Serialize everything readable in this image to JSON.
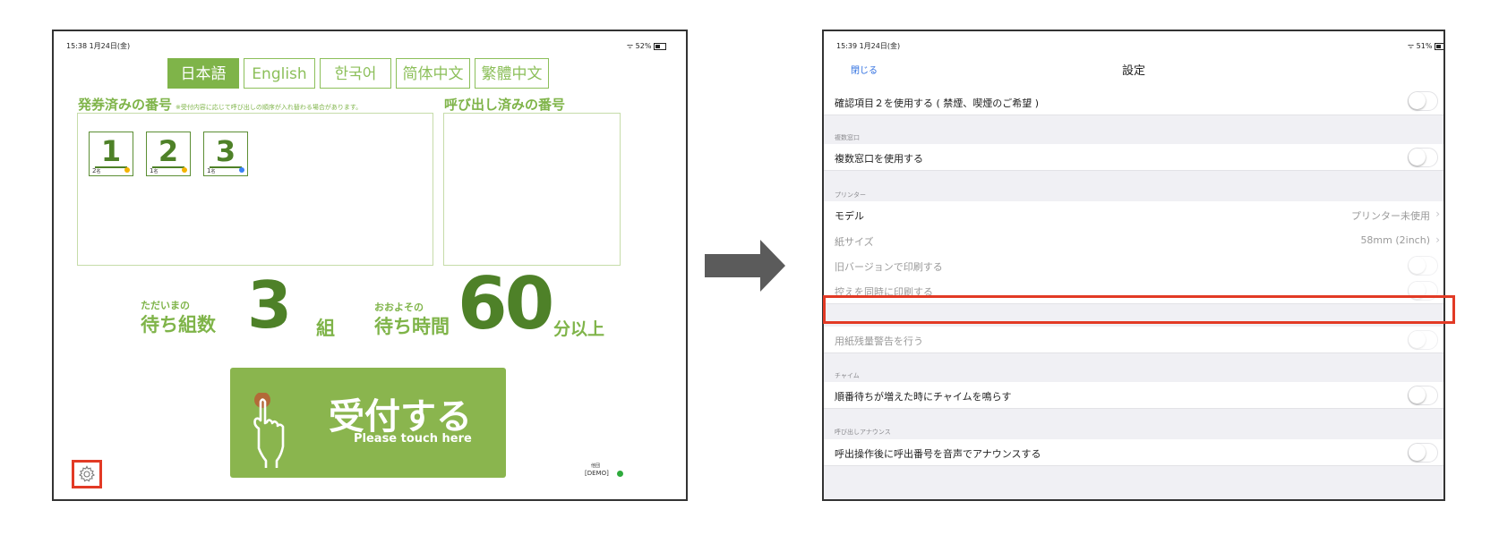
{
  "left": {
    "status_time": "15:38  1月24日(金)",
    "status_battery": "52%",
    "tabs": [
      "日本語",
      "English",
      "한국어",
      "简体中文",
      "繁體中文"
    ],
    "issued": {
      "title": "発券済みの番号",
      "note": "※受付内容に応じて呼び出しの順序が入れ替わる場合があります。",
      "tickets": [
        {
          "number": "1",
          "count": "2",
          "unit": "名",
          "dot_color": "#f4b400"
        },
        {
          "number": "2",
          "count": "1",
          "unit": "名",
          "dot_color": "#f4b400"
        },
        {
          "number": "3",
          "count": "1",
          "unit": "名",
          "dot_color": "#3b82f6"
        }
      ]
    },
    "called": {
      "title": "呼び出し済みの番号"
    },
    "wait_groups": {
      "small": "ただいまの",
      "label": "待ち組数",
      "value": "3",
      "unit": "組"
    },
    "wait_time": {
      "small": "おおよその",
      "label": "待ち時間",
      "value": "60",
      "unit": "分以上"
    },
    "accept_button": {
      "label": "受付する",
      "sub": "Please touch here"
    },
    "demo_small": "他団",
    "demo_label": "[DEMO]",
    "settings_icon": "gear-icon",
    "colors": {
      "accent": "#7fb449",
      "dark_green": "#4e8128",
      "button": "#8ab54e",
      "highlight": "#e23a25"
    }
  },
  "right": {
    "status_time": "15:39  1月24日(金)",
    "status_battery": "51%",
    "close_label": "閉じる",
    "nav_title": "設定",
    "rows": {
      "confirm2": "確認項目２を使用する ( 禁煙、喫煙のご希望 )",
      "multi_window_header": "複数窓口",
      "multi_window": "複数窓口を使用する",
      "printer_header": "プリンター",
      "model": "モデル",
      "model_value": "プリンター未使用",
      "paper_size": "紙サイズ",
      "paper_size_value": "58mm (2inch)",
      "old_version_print": "旧バージョンで印刷する",
      "copy_print": "控えを同時に印刷する",
      "paper_warning": "用紙残量警告を行う",
      "chime_header": "チャイム",
      "chime": "順番待ちが増えた時にチャイムを鳴らす",
      "announce_header": "呼び出しアナウンス",
      "announce": "呼出操作後に呼出番号を音声でアナウンスする"
    }
  }
}
